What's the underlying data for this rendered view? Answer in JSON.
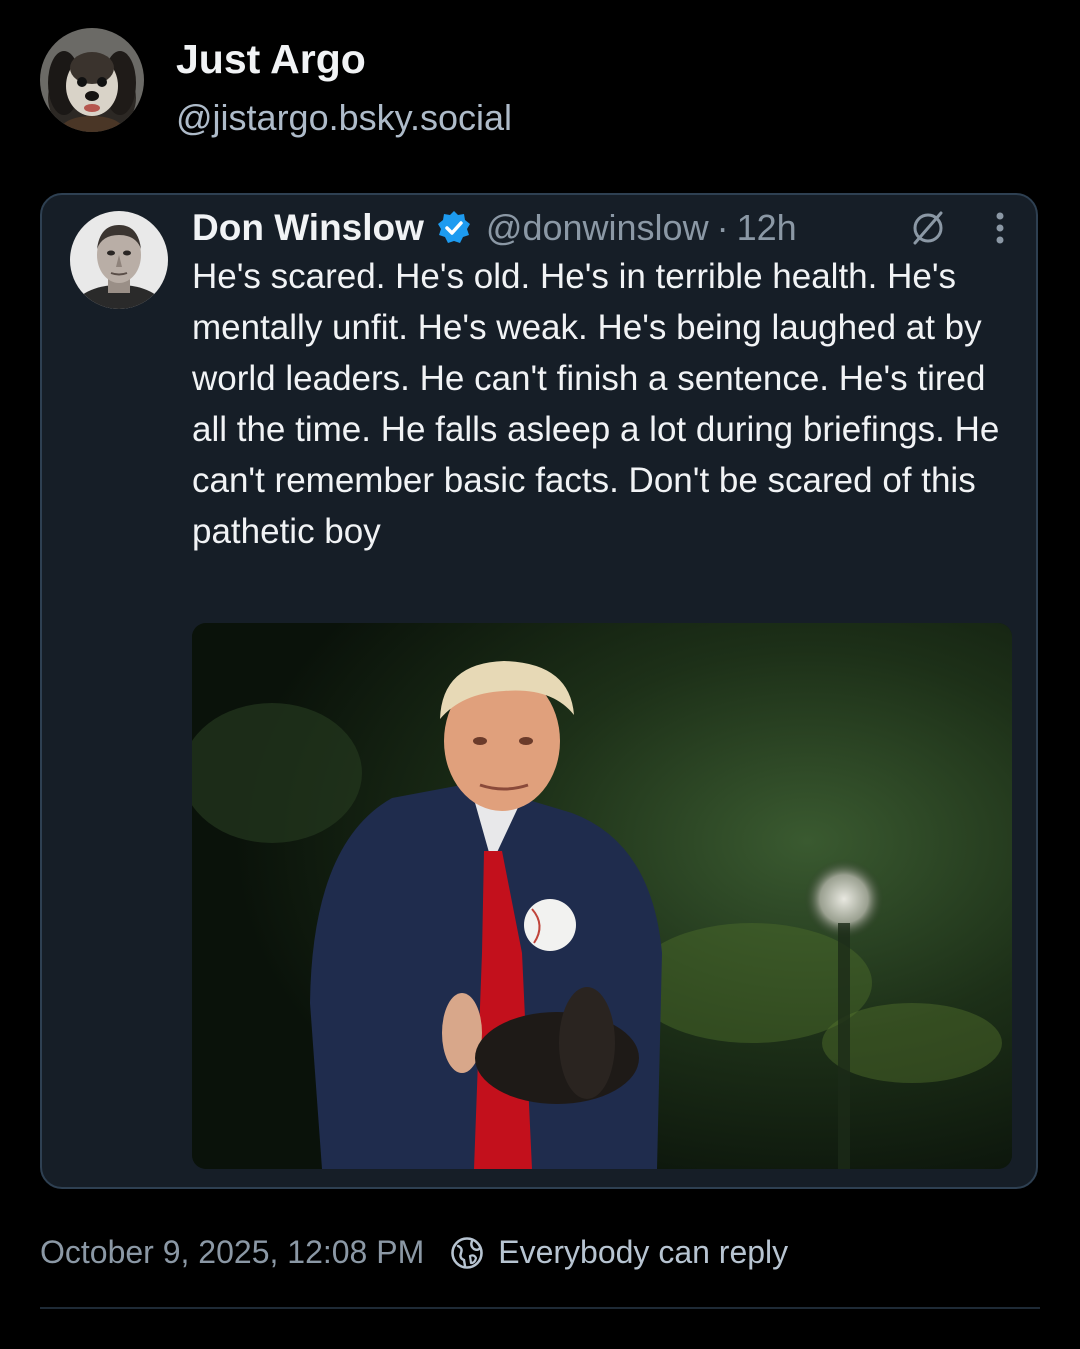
{
  "post": {
    "author_name": "Just Argo",
    "author_handle": "@jistargo.bsky.social",
    "author_avatar_icon": "dog-avatar-icon"
  },
  "quoted_post": {
    "author_name": "Don Winslow",
    "verified_icon": "verified-check-icon",
    "handle": "@donwinslow",
    "separator": "·",
    "time": "12h",
    "text": "He's scared. He's old. He's in terrible health. He's mentally unfit. He's weak. He's being laughed at by world leaders. He can't finish a sentence. He's tired all the time. He falls asleep a lot during briefings. He can't remember basic facts. Don't be scared of this pathetic boy",
    "media_icon": "photo-man-catching-baseball"
  },
  "footer": {
    "date": "October 9, 2025, 12:08 PM",
    "reply_setting": "Everybody can reply",
    "reply_icon": "globe-icon"
  },
  "colors": {
    "background": "#000000",
    "card": "#161e27",
    "card_border": "#2e4052",
    "verified": "#1d9bf0",
    "muted_text": "#8b98a5"
  }
}
